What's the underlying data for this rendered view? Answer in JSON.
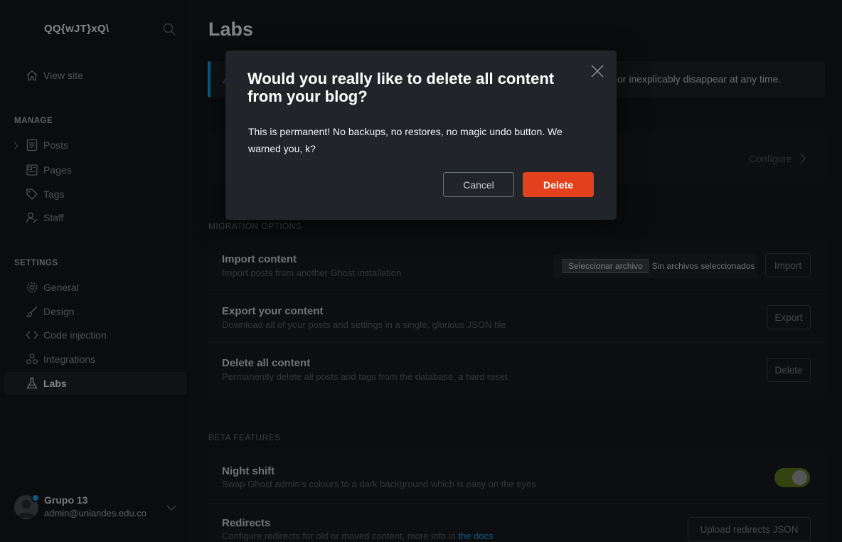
{
  "sidebar": {
    "site_title": "QQ{wJT}xQ\\",
    "view_site": "View site",
    "manage_label": "MANAGE",
    "manage_items": [
      {
        "label": "Posts"
      },
      {
        "label": "Pages"
      },
      {
        "label": "Tags"
      },
      {
        "label": "Staff"
      }
    ],
    "settings_label": "SETTINGS",
    "settings_items": [
      {
        "label": "General"
      },
      {
        "label": "Design"
      },
      {
        "label": "Code injection"
      },
      {
        "label": "Integrations"
      },
      {
        "label": "Labs"
      }
    ],
    "user": {
      "name": "Grupo 13",
      "email": "admin@uniandes.edu.co"
    }
  },
  "main": {
    "title": "Labs",
    "alert_text": "or inexplicably disappear at any time.",
    "configure_label": "Configure",
    "migration_label": "MIGRATION OPTIONS",
    "migration_rows": [
      {
        "title": "Import content",
        "desc": "Import posts from another Ghost installation",
        "button": "Import"
      },
      {
        "title": "Export your content",
        "desc": "Download all of your posts and settings in a single, glorious JSON file",
        "button": "Export"
      },
      {
        "title": "Delete all content",
        "desc": "Permanently delete all posts and tags from the database, a hard reset",
        "button": "Delete"
      }
    ],
    "file_input": {
      "button": "Seleccionar archivo",
      "status": "Sin archivos seleccionados"
    },
    "beta_label": "BETA FEATURES",
    "night_shift": {
      "title": "Night shift",
      "desc": "Swap Ghost admin's colours to a dark background which is easy on the eyes",
      "enabled": true
    },
    "redirects": {
      "title": "Redirects",
      "desc": "Configure redirects for old or moved content, more info in ",
      "link": "the docs",
      "button": "Upload redirects JSON"
    }
  },
  "modal": {
    "title": "Would you really like to delete all content from your blog?",
    "body": "This is permanent! No backups, no restores, no magic undo button. We warned you, k?",
    "cancel": "Cancel",
    "confirm": "Delete",
    "confirm_color": "#e3401d"
  },
  "colors": {
    "accent": "#14a4ed",
    "toggle_on": "#5b7a1e",
    "danger": "#e3401d"
  }
}
